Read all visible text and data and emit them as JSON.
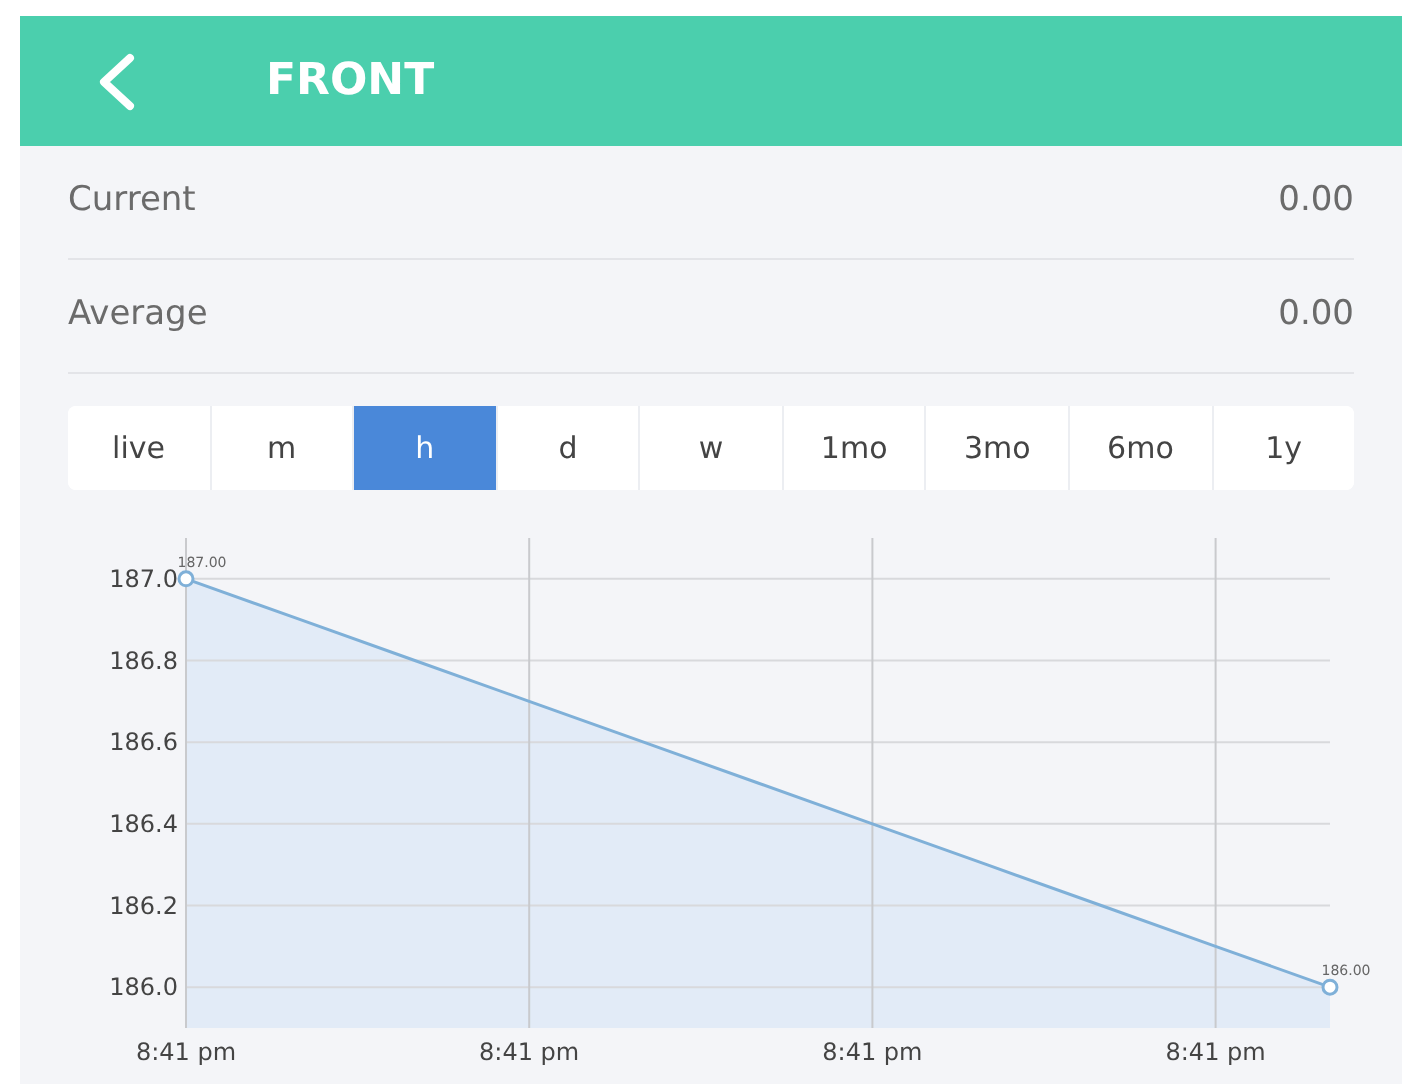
{
  "header": {
    "title": "FRONT"
  },
  "stats": [
    {
      "label": "Current",
      "value": "0.00"
    },
    {
      "label": "Average",
      "value": "0.00"
    }
  ],
  "tabs": [
    {
      "label": "live",
      "selected": false
    },
    {
      "label": "m",
      "selected": false
    },
    {
      "label": "h",
      "selected": true
    },
    {
      "label": "d",
      "selected": false
    },
    {
      "label": "w",
      "selected": false
    },
    {
      "label": "1mo",
      "selected": false
    },
    {
      "label": "3mo",
      "selected": false
    },
    {
      "label": "6mo",
      "selected": false
    },
    {
      "label": "1y",
      "selected": false
    }
  ],
  "chart_data": {
    "type": "area",
    "categories": [
      "8:41 pm",
      null,
      null,
      "8:41 pm",
      null,
      null,
      "8:41 pm",
      null,
      null,
      "8:41 pm",
      null
    ],
    "ylim": [
      185.9,
      187.1
    ],
    "grid": true,
    "series": [
      {
        "color": "#7fb0d8",
        "values": [
          187.0,
          186.9,
          186.8,
          186.7,
          186.6,
          186.5,
          186.4,
          186.3,
          186.2,
          186.1,
          186.0
        ]
      }
    ],
    "yticks": [
      {
        "value": 186.0,
        "label": "186.0"
      },
      {
        "value": 186.2,
        "label": "186.2"
      },
      {
        "value": 186.4,
        "label": "186.4"
      },
      {
        "value": 186.6,
        "label": "186.6"
      },
      {
        "value": 186.8,
        "label": "186.8"
      },
      {
        "value": 187.0,
        "label": "187.0"
      }
    ],
    "value_labels": [
      "187.00",
      null,
      null,
      null,
      null,
      null,
      null,
      null,
      null,
      null,
      "186.00"
    ]
  }
}
